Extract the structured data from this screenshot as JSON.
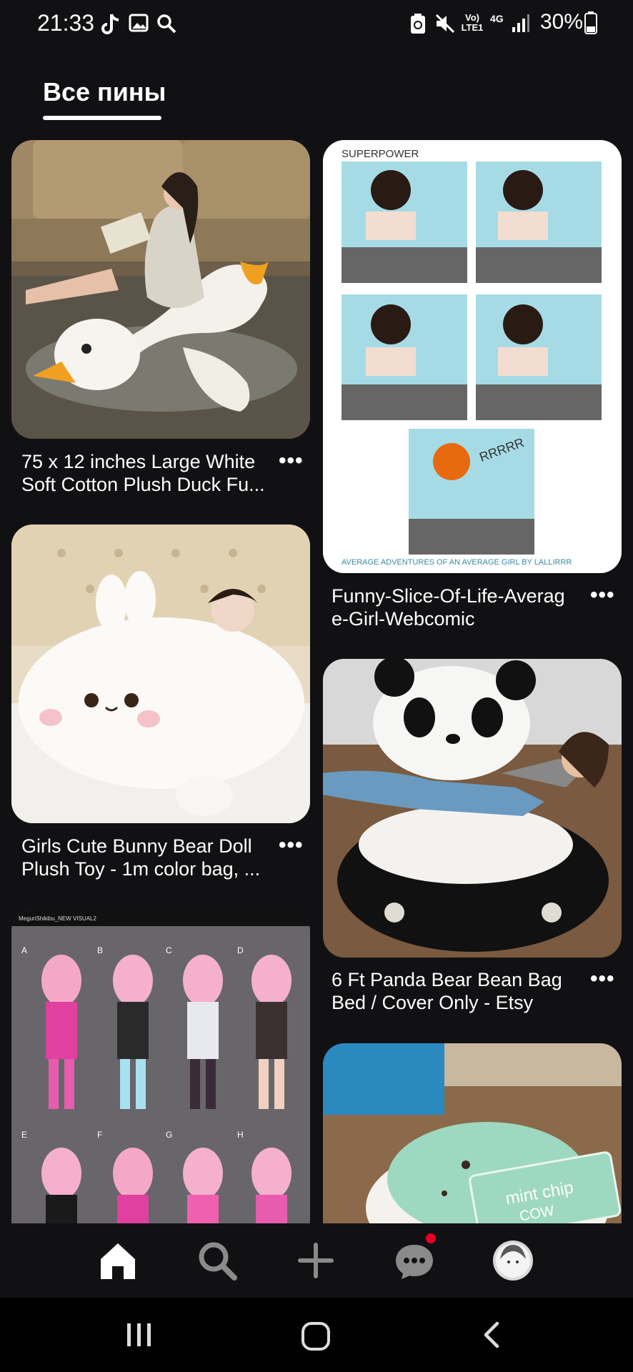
{
  "status_bar": {
    "time": "21:33",
    "network": "Vo) LTE1",
    "signal": "4G",
    "battery": "30%",
    "icons": [
      "tiktok-icon",
      "gallery-icon",
      "search-icon",
      "ai-icon",
      "mute-icon",
      "volte-icon",
      "signal-icon",
      "battery-icon"
    ]
  },
  "header": {
    "tab_label": "Все пины"
  },
  "pins": [
    {
      "title_line1": "75 x 12 inches Large White",
      "title_line2": "Soft Cotton Plush Duck Fu...",
      "more": "•••"
    },
    {
      "title_line1": "Funny-Slice-Of-Life-Averag",
      "title_line2": "e-Girl-Webcomic",
      "more": "•••"
    },
    {
      "title_line1": "Girls Cute Bunny Bear Doll",
      "title_line2": "Plush Toy - 1m color bag, ...",
      "more": "•••"
    },
    {
      "title_line1": "6 Ft Panda Bear Bean Bag",
      "title_line2": "Bed / Cover Only - Etsy",
      "more": "•••"
    },
    {
      "title_line1": "",
      "title_line2": "",
      "more": ""
    },
    {
      "title_line1": "",
      "title_line2": "",
      "more": ""
    }
  ],
  "comic": {
    "top_label": "SUPERPOWER",
    "caption": "AVERAGE ADVENTURES OF AN AVERAGE GIRL BY LALLIRRR",
    "sound": "RRRRR"
  },
  "anime": {
    "header": "MeguriShikibu_NEW VISUAL2",
    "letters": [
      "A",
      "B",
      "C",
      "D",
      "E",
      "F",
      "G",
      "H"
    ]
  },
  "icecream": {
    "sign": "mint chip",
    "sign2": "COW"
  },
  "bottom_nav": {
    "items": [
      "home-icon",
      "search-icon",
      "plus-icon",
      "messages-icon",
      "profile-avatar"
    ],
    "active": "home",
    "notification_color": "#e60023"
  },
  "system_nav": {
    "items": [
      "recents-icon",
      "home-button-icon",
      "back-icon"
    ]
  }
}
